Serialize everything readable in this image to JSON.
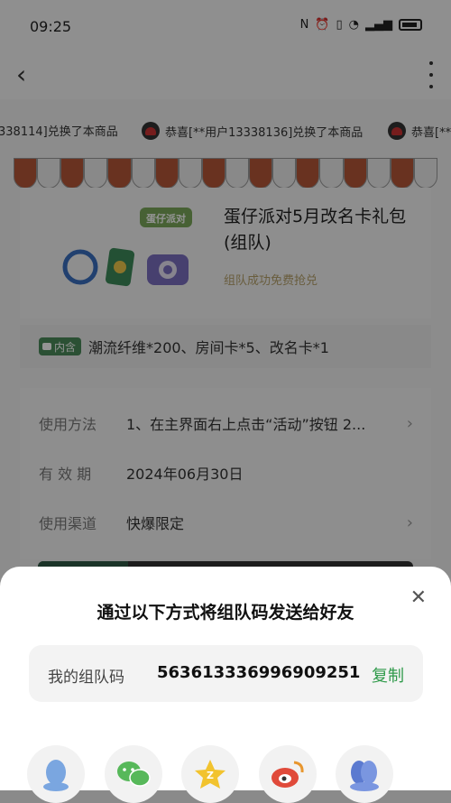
{
  "status_bar": {
    "time": "09:25"
  },
  "marquee": {
    "items": [
      "338114]兑换了本商品",
      "恭喜[**用户13338136]兑换了本商品",
      "恭喜[**"
    ]
  },
  "product": {
    "image_label": "蛋仔派对",
    "title": "蛋仔派对5月改名卡礼包(组队)",
    "subtitle": "组队成功免费抢兑"
  },
  "includes": {
    "badge": "内含",
    "text": "潮流纤维*200、房间卡*5、改名卡*1"
  },
  "info": [
    {
      "label": "使用方法",
      "value": "1、在主界面右上点击“活动”按钮 2...",
      "has_chevron": true
    },
    {
      "label": "有 效 期",
      "value": "2024年06月30日",
      "has_chevron": false
    },
    {
      "label": "使用渠道",
      "value": "快爆限定",
      "has_chevron": true
    }
  ],
  "sheet": {
    "title": "通过以下方式将组队码发送给好友",
    "code_label": "我的组队码",
    "code_value": "563613336996909251",
    "copy_label": "复制",
    "share_targets": [
      "qq-icon",
      "wechat-icon",
      "qzone-icon",
      "weibo-icon",
      "qq-friends-icon"
    ]
  },
  "colors": {
    "accent_green": "#2f9a4a",
    "awning_red": "#b65638"
  }
}
